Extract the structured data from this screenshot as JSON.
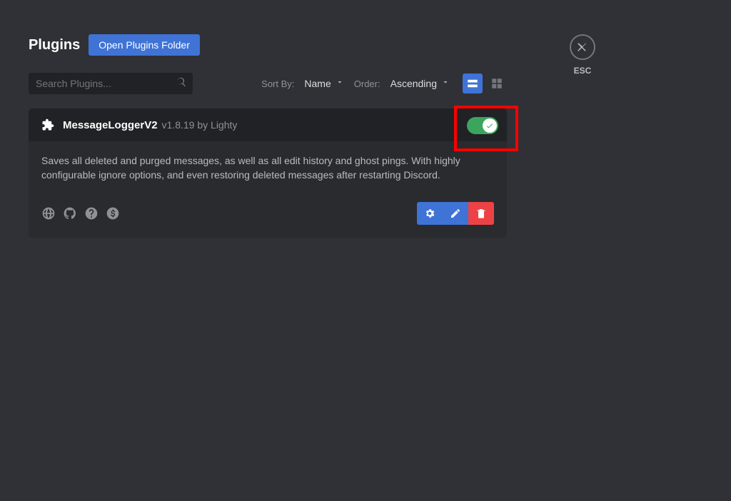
{
  "header": {
    "title": "Plugins",
    "open_folder_label": "Open Plugins Folder"
  },
  "close": {
    "esc_label": "ESC"
  },
  "controls": {
    "search_placeholder": "Search Plugins...",
    "sort_by_label": "Sort By:",
    "sort_by_value": "Name",
    "order_label": "Order:",
    "order_value": "Ascending",
    "view_mode": "list"
  },
  "plugin": {
    "name": "MessageLoggerV2",
    "version": "v1.8.19",
    "author": "Lighty",
    "meta": "v1.8.19 by Lighty",
    "description": "Saves all deleted and purged messages, as well as all edit history and ghost pings. With highly configurable ignore options, and even restoring deleted messages after restarting Discord.",
    "enabled": true,
    "links": {
      "website": "website",
      "github": "github",
      "help": "help",
      "donate": "donate"
    },
    "actions": {
      "settings": "settings",
      "edit": "edit",
      "delete": "delete"
    }
  }
}
